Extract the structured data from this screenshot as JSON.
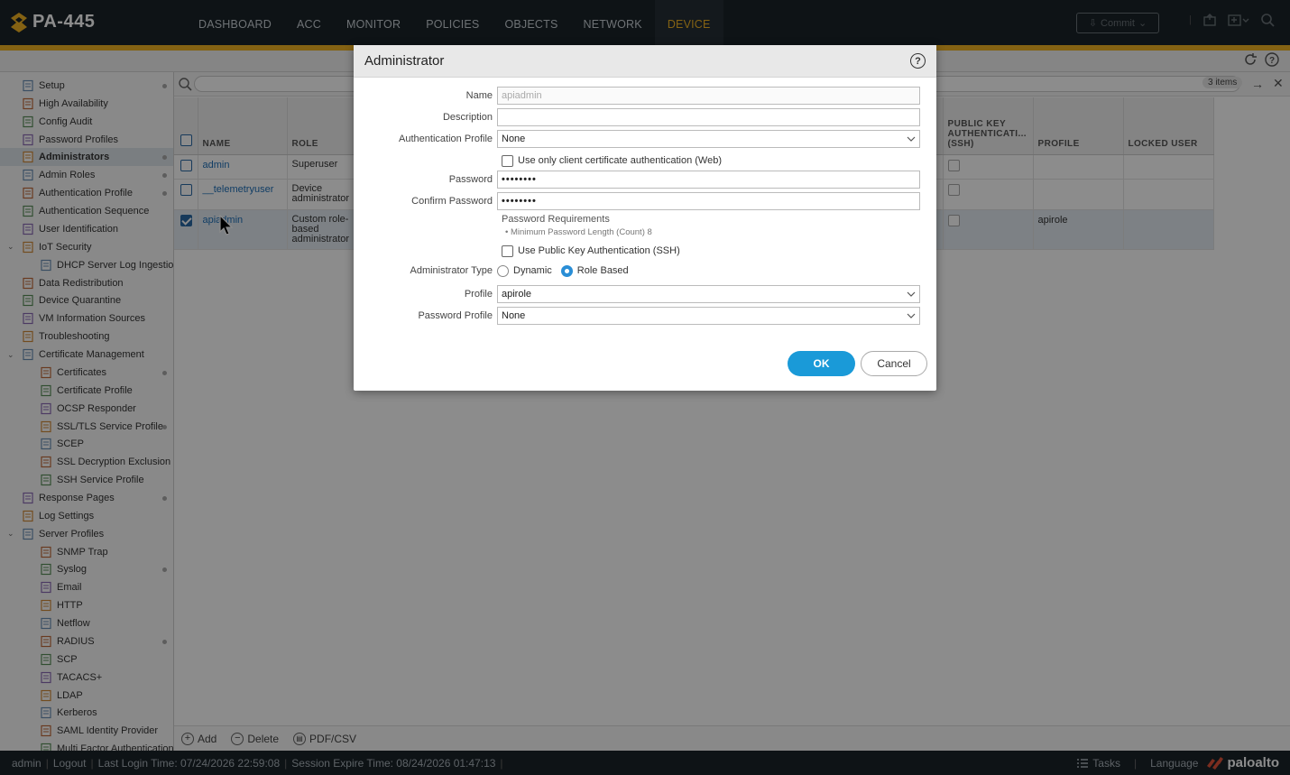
{
  "app": {
    "title": "PA-445"
  },
  "nav": {
    "tabs": [
      "DASHBOARD",
      "ACC",
      "MONITOR",
      "POLICIES",
      "OBJECTS",
      "NETWORK",
      "DEVICE"
    ],
    "active": "DEVICE"
  },
  "commit": {
    "label": "Commit"
  },
  "sidebar": {
    "items": [
      {
        "label": "Setup",
        "indent": 0,
        "dot": true,
        "icon": "setup-icon"
      },
      {
        "label": "High Availability",
        "indent": 0,
        "dot": false,
        "icon": "ha-icon"
      },
      {
        "label": "Config Audit",
        "indent": 0,
        "dot": false,
        "icon": "audit-icon"
      },
      {
        "label": "Password Profiles",
        "indent": 0,
        "dot": false,
        "icon": "password-icon"
      },
      {
        "label": "Administrators",
        "indent": 0,
        "dot": true,
        "icon": "admin-icon",
        "active": true
      },
      {
        "label": "Admin Roles",
        "indent": 0,
        "dot": true,
        "icon": "roles-icon"
      },
      {
        "label": "Authentication Profile",
        "indent": 0,
        "dot": true,
        "icon": "auth-icon"
      },
      {
        "label": "Authentication Sequence",
        "indent": 0,
        "dot": false,
        "icon": "auth-seq-icon"
      },
      {
        "label": "User Identification",
        "indent": 0,
        "dot": false,
        "icon": "user-id-icon"
      },
      {
        "label": "IoT Security",
        "indent": 0,
        "dot": false,
        "icon": "iot-icon",
        "caret": true
      },
      {
        "label": "DHCP Server Log Ingestion",
        "indent": 1,
        "dot": false,
        "icon": "dhcp-icon"
      },
      {
        "label": "Data Redistribution",
        "indent": 0,
        "dot": false,
        "icon": "redistribution-icon"
      },
      {
        "label": "Device Quarantine",
        "indent": 0,
        "dot": false,
        "icon": "quarantine-icon"
      },
      {
        "label": "VM Information Sources",
        "indent": 0,
        "dot": false,
        "icon": "vm-icon"
      },
      {
        "label": "Troubleshooting",
        "indent": 0,
        "dot": false,
        "icon": "troubleshoot-icon"
      },
      {
        "label": "Certificate Management",
        "indent": 0,
        "dot": false,
        "icon": "cert-mgmt-icon",
        "caret": true
      },
      {
        "label": "Certificates",
        "indent": 1,
        "dot": true,
        "icon": "certificate-icon"
      },
      {
        "label": "Certificate Profile",
        "indent": 1,
        "dot": false,
        "icon": "certificate-icon"
      },
      {
        "label": "OCSP Responder",
        "indent": 1,
        "dot": false,
        "icon": "certificate-icon"
      },
      {
        "label": "SSL/TLS Service Profile",
        "indent": 1,
        "dot": true,
        "icon": "lock-icon"
      },
      {
        "label": "SCEP",
        "indent": 1,
        "dot": false,
        "icon": "scep-icon"
      },
      {
        "label": "SSL Decryption Exclusion",
        "indent": 1,
        "dot": false,
        "icon": "lock-icon"
      },
      {
        "label": "SSH Service Profile",
        "indent": 1,
        "dot": false,
        "icon": "certificate-icon"
      },
      {
        "label": "Response Pages",
        "indent": 0,
        "dot": true,
        "icon": "response-icon"
      },
      {
        "label": "Log Settings",
        "indent": 0,
        "dot": false,
        "icon": "log-icon"
      },
      {
        "label": "Server Profiles",
        "indent": 0,
        "dot": false,
        "icon": "server-icon",
        "caret": true
      },
      {
        "label": "SNMP Trap",
        "indent": 1,
        "dot": false,
        "icon": "server-profile-icon"
      },
      {
        "label": "Syslog",
        "indent": 1,
        "dot": true,
        "icon": "server-profile-icon"
      },
      {
        "label": "Email",
        "indent": 1,
        "dot": false,
        "icon": "server-profile-icon"
      },
      {
        "label": "HTTP",
        "indent": 1,
        "dot": false,
        "icon": "server-profile-icon"
      },
      {
        "label": "Netflow",
        "indent": 1,
        "dot": false,
        "icon": "server-profile-icon"
      },
      {
        "label": "RADIUS",
        "indent": 1,
        "dot": true,
        "icon": "server-profile-icon"
      },
      {
        "label": "SCP",
        "indent": 1,
        "dot": false,
        "icon": "server-profile-icon"
      },
      {
        "label": "TACACS+",
        "indent": 1,
        "dot": false,
        "icon": "server-profile-icon"
      },
      {
        "label": "LDAP",
        "indent": 1,
        "dot": false,
        "icon": "server-profile-icon"
      },
      {
        "label": "Kerberos",
        "indent": 1,
        "dot": false,
        "icon": "server-profile-icon"
      },
      {
        "label": "SAML Identity Provider",
        "indent": 1,
        "dot": false,
        "icon": "server-profile-icon"
      },
      {
        "label": "Multi Factor Authentication",
        "indent": 1,
        "dot": false,
        "icon": "server-profile-icon"
      }
    ]
  },
  "table": {
    "count_label": "3 items",
    "columns": [
      "NAME",
      "ROLE",
      "PUBLIC KEY AUTHENTICATI... (SSH)",
      "PROFILE",
      "LOCKED USER"
    ],
    "rows": [
      {
        "name": "admin",
        "role": "Superuser",
        "profile": "",
        "checked": false,
        "selected": false
      },
      {
        "name": "__telemetryuser",
        "role": "Device administrator",
        "profile": "",
        "checked": false,
        "selected": false
      },
      {
        "name": "apiadmin",
        "role": "Custom role-based administrator",
        "profile": "apirole",
        "checked": true,
        "selected": true
      }
    ]
  },
  "actions": {
    "add": "Add",
    "delete": "Delete",
    "pdf": "PDF/CSV"
  },
  "footer": {
    "user": "admin",
    "logout": "Logout",
    "last_login": "Last Login Time: 07/24/2026 22:59:08",
    "session_expire": "Session Expire Time: 08/24/2026 01:47:13",
    "tasks": "Tasks",
    "language": "Language",
    "brand": "paloalto"
  },
  "dialog": {
    "title": "Administrator",
    "name_label": "Name",
    "name_value": "apiadmin",
    "description_label": "Description",
    "description_value": "",
    "auth_profile_label": "Authentication Profile",
    "auth_profile_value": "None",
    "client_cert_label": "Use only client certificate authentication (Web)",
    "password_label": "Password",
    "password_value": "••••••••",
    "confirm_label": "Confirm Password",
    "confirm_value": "••••••••",
    "requirements_title": "Password Requirements",
    "requirements_item": "Minimum Password Length (Count) 8",
    "public_key_label": "Use Public Key Authentication (SSH)",
    "admin_type_label": "Administrator Type",
    "admin_type_dynamic": "Dynamic",
    "admin_type_role": "Role Based",
    "profile_label": "Profile",
    "profile_value": "apirole",
    "password_profile_label": "Password Profile",
    "password_profile_value": "None",
    "ok": "OK",
    "cancel": "Cancel"
  },
  "colors": {
    "topbar": "#1a2329",
    "accent": "#f0b323",
    "ok_button": "#1a9ad8",
    "link": "#1e6fb8"
  }
}
